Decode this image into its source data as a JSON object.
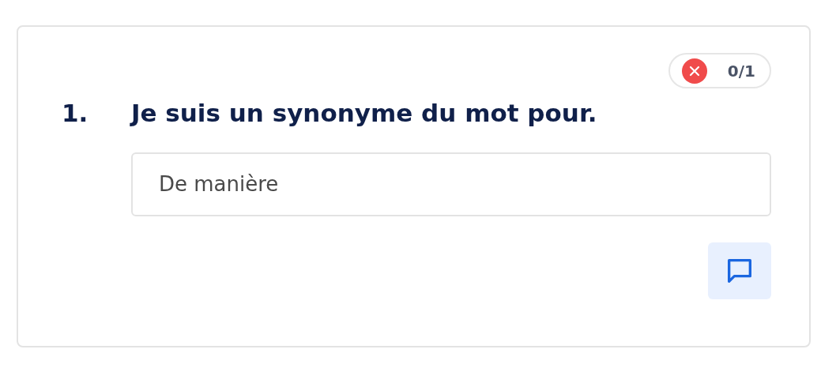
{
  "question": {
    "number": "1.",
    "text": "Je suis un synonyme du mot pour.",
    "correct": false,
    "score": "0/1",
    "answer": "De manière"
  }
}
